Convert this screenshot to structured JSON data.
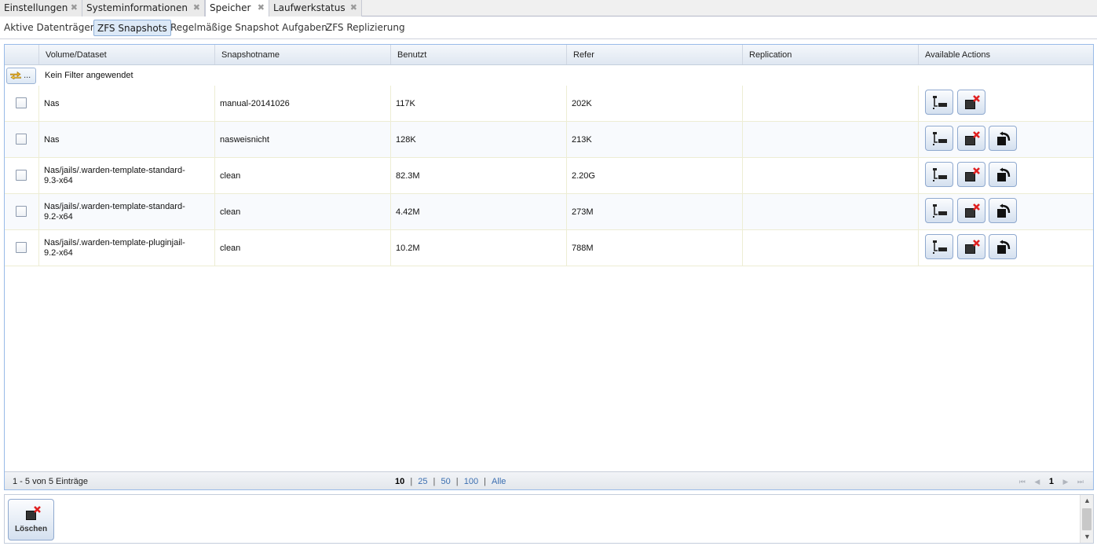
{
  "tabs": [
    {
      "label": "Einstellungen",
      "close": "✖"
    },
    {
      "label": "Systeminformationen",
      "close": "✖"
    },
    {
      "label": "Speicher",
      "close": "✖"
    },
    {
      "label": "Laufwerkstatus",
      "close": "✖"
    }
  ],
  "subtabs": [
    {
      "label": "Aktive Datenträger"
    },
    {
      "label": "ZFS Snapshots"
    },
    {
      "label": "Regelmäßige Snapshot Aufgaben"
    },
    {
      "label": "ZFS Replizierung"
    }
  ],
  "grid": {
    "columns": [
      "Volume/Dataset",
      "Snapshotname",
      "Benutzt",
      "Refer",
      "Replication",
      "Available Actions"
    ],
    "filter_button_label": "...",
    "filter_text": "Kein Filter angewendet",
    "rows": [
      {
        "volume": "Nas",
        "snapshot": "manual-20141026",
        "used": "117K",
        "refer": "202K",
        "replication": ""
      },
      {
        "volume": "Nas",
        "snapshot": "nasweisnicht",
        "used": "128K",
        "refer": "213K",
        "replication": ""
      },
      {
        "volume": "Nas/jails/.warden-template-standard-9.3-x64",
        "snapshot": "clean",
        "used": "82.3M",
        "refer": "2.20G",
        "replication": ""
      },
      {
        "volume": "Nas/jails/.warden-template-standard-9.2-x64",
        "snapshot": "clean",
        "used": "4.42M",
        "refer": "273M",
        "replication": ""
      },
      {
        "volume": "Nas/jails/.warden-template-pluginjail-9.2-x64",
        "snapshot": "clean",
        "used": "10.2M",
        "refer": "788M",
        "replication": ""
      }
    ]
  },
  "paging": {
    "info": "1 - 5 von 5 Einträge",
    "sizes": [
      "10",
      "25",
      "50",
      "100",
      "Alle"
    ],
    "separator": "|",
    "current_size": "10",
    "current_page": "1",
    "first": "⏮",
    "prev": "◀",
    "next": "▶",
    "last": "⏭"
  },
  "bottom": {
    "delete_label": "Löschen"
  },
  "colors": {
    "border_blue": "#99bbe8",
    "accent_red": "#e02020",
    "link": "#3b6eb0"
  }
}
